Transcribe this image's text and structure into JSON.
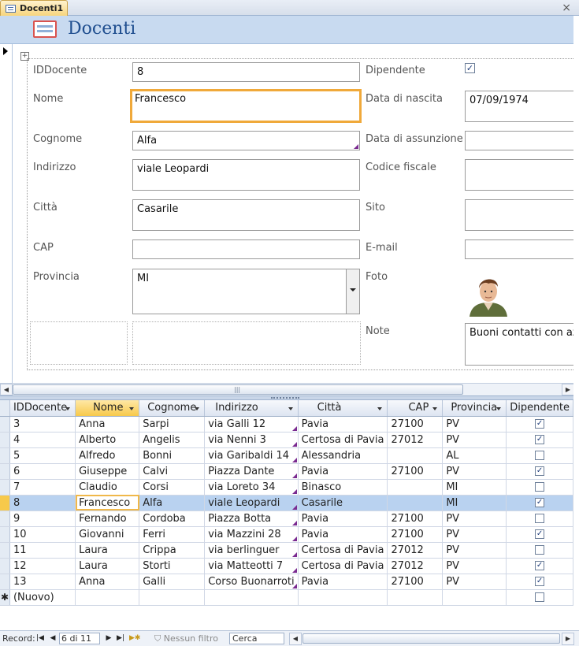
{
  "tab": {
    "label": "Docenti1",
    "close": "×"
  },
  "header": {
    "title": "Docenti"
  },
  "form": {
    "labels": {
      "iddocente": "IDDocente",
      "nome": "Nome",
      "cognome": "Cognome",
      "indirizzo": "Indirizzo",
      "citta": "Città",
      "cap": "CAP",
      "provincia": "Provincia",
      "dipendente": "Dipendente",
      "nascita": "Data di nascita",
      "assunzione": "Data di assunzione",
      "codfisc": "Codice fiscale",
      "sito": "Sito",
      "email": "E-mail",
      "foto": "Foto",
      "note": "Note"
    },
    "values": {
      "iddocente": "8",
      "nome": "Francesco",
      "cognome": "Alfa",
      "indirizzo": "viale Leopardi",
      "citta": "Casarile",
      "cap": "",
      "provincia": "MI",
      "dipendente": "✓",
      "nascita": "07/09/1974",
      "assunzione": "",
      "codfisc": "",
      "sito": "",
      "email": "",
      "note": "Buoni contatti con aziende"
    }
  },
  "sheet": {
    "columns": [
      "IDDocente",
      "Nome",
      "Cognome",
      "Indirizzo",
      "Città",
      "CAP",
      "Provincia",
      "Dipendente"
    ],
    "rows": [
      [
        "3",
        "Anna",
        "Sarpi",
        "via Galli 12",
        "Pavia",
        "27100",
        "PV",
        "✓"
      ],
      [
        "4",
        "Alberto",
        "Angelis",
        "via Nenni 3",
        "Certosa di Pavia",
        "27012",
        "PV",
        "✓"
      ],
      [
        "5",
        "Alfredo",
        "Bonni",
        "via Garibaldi 14",
        "Alessandria",
        "",
        "AL",
        ""
      ],
      [
        "6",
        "Giuseppe",
        "Calvi",
        "Piazza Dante",
        "Pavia",
        "27100",
        "PV",
        "✓"
      ],
      [
        "7",
        "Claudio",
        "Corsi",
        "via Loreto 34",
        "Binasco",
        "",
        "MI",
        ""
      ],
      [
        "8",
        "Francesco",
        "Alfa",
        "viale Leopardi",
        "Casarile",
        "",
        "MI",
        "✓"
      ],
      [
        "9",
        "Fernando",
        "Cordoba",
        "Piazza Botta",
        "Pavia",
        "27100",
        "PV",
        ""
      ],
      [
        "10",
        "Giovanni",
        "Ferri",
        "via Mazzini 28",
        "Pavia",
        "27100",
        "PV",
        "✓"
      ],
      [
        "11",
        "Laura",
        "Crippa",
        "via berlinguer",
        "Certosa di Pavia",
        "27012",
        "PV",
        ""
      ],
      [
        "12",
        "Laura",
        "Storti",
        "via Matteotti 7",
        "Certosa di Pavia",
        "27012",
        "PV",
        "✓"
      ],
      [
        "13",
        "Anna",
        "Galli",
        "Corso Buonarroti",
        "Pavia",
        "27100",
        "PV",
        "✓"
      ]
    ],
    "new_row_label": "(Nuovo)",
    "current_index": 5
  },
  "nav": {
    "record_label": "Record:",
    "position": "6 di 11",
    "filter_label": "Nessun filtro",
    "search_placeholder": "Cerca"
  }
}
